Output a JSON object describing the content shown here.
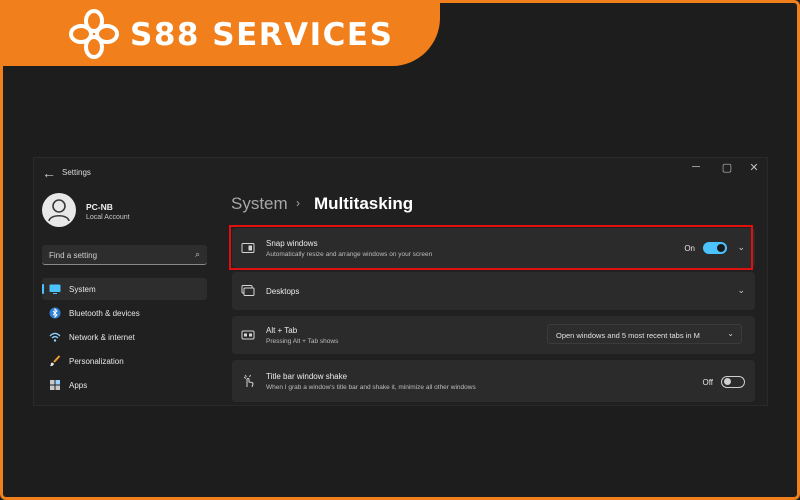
{
  "brand": {
    "name": "S88 SERVICES",
    "color": "#f07f1c"
  },
  "window": {
    "app_title": "Settings",
    "back_icon": "arrow-left-icon",
    "controls": {
      "minimize": "─",
      "maximize": "▢",
      "close": "✕"
    }
  },
  "account": {
    "name": "PC-NB",
    "type": "Local Account"
  },
  "search": {
    "placeholder": "Find a setting",
    "icon": "search-icon"
  },
  "sidebar": {
    "items": [
      {
        "label": "System",
        "icon": "system-icon",
        "active": true
      },
      {
        "label": "Bluetooth & devices",
        "icon": "bluetooth-icon"
      },
      {
        "label": "Network & internet",
        "icon": "wifi-icon"
      },
      {
        "label": "Personalization",
        "icon": "brush-icon"
      },
      {
        "label": "Apps",
        "icon": "apps-icon"
      }
    ]
  },
  "header": {
    "breadcrumb": "System",
    "separator": "›",
    "title": "Multitasking"
  },
  "settings": {
    "snap": {
      "title": "Snap windows",
      "desc": "Automatically resize and arrange windows on your screen",
      "state_label": "On",
      "enabled": true,
      "icon": "snap-windows-icon"
    },
    "desktops": {
      "title": "Desktops",
      "icon": "desktops-icon"
    },
    "alttab": {
      "title": "Alt + Tab",
      "desc": "Pressing Alt + Tab shows",
      "selected": "Open windows and 5 most recent tabs in M",
      "icon": "alt-tab-icon"
    },
    "shake": {
      "title": "Title bar window shake",
      "desc": "When I grab a window's title bar and shake it, minimize all other windows",
      "state_label": "Off",
      "enabled": false,
      "icon": "shake-icon"
    }
  },
  "colors": {
    "accent": "#4cc2ff",
    "highlight": "#e01010",
    "background": "#202020",
    "card": "#2b2b2b"
  }
}
